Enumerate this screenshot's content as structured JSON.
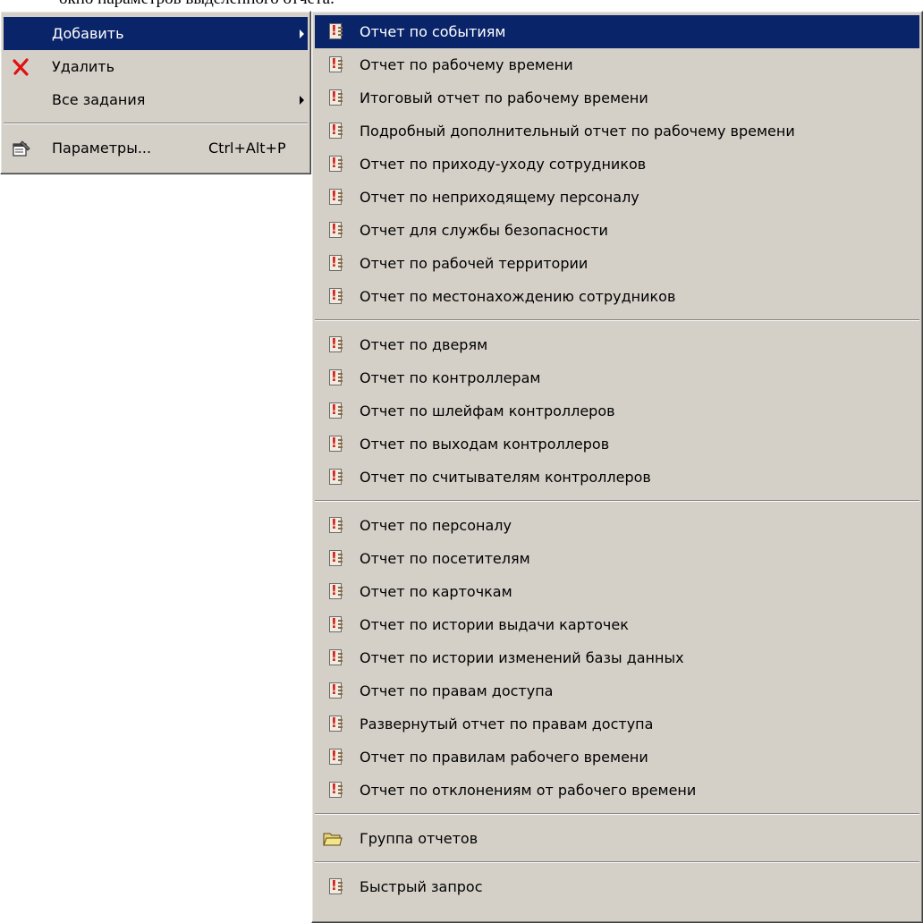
{
  "doc_fragment": "окно параметров выделенного отчета.",
  "context_menu": {
    "items": [
      {
        "label": "Добавить",
        "icon": "none",
        "has_submenu": true,
        "highlighted": true
      },
      {
        "label": "Удалить",
        "icon": "delete-x-icon",
        "has_submenu": false
      },
      {
        "label": "Все задания",
        "icon": "none",
        "has_submenu": true
      },
      {
        "label": "Параметры...",
        "icon": "properties-icon",
        "shortcut": "Ctrl+Alt+P"
      }
    ]
  },
  "submenu": {
    "group1": [
      "Отчет по событиям",
      "Отчет по рабочему времени",
      "Итоговый отчет по рабочему времени",
      "Подробный дополнительный отчет по рабочему времени",
      "Отчет по приходу-уходу сотрудников",
      "Отчет по неприходящему персоналу",
      "Отчет для службы безопасности",
      "Отчет по рабочей территории",
      "Отчет по местонахождению сотрудников"
    ],
    "group2": [
      "Отчет по дверям",
      "Отчет по контроллерам",
      "Отчет по шлейфам контроллеров",
      "Отчет по выходам контроллеров",
      "Отчет по считывателям контроллеров"
    ],
    "group3": [
      "Отчет по персоналу",
      "Отчет по посетителям",
      "Отчет по карточкам",
      "Отчет по истории выдачи карточек",
      "Отчет по истории изменений базы данных",
      "Отчет по правам доступа",
      "Развернутый отчет по правам доступа",
      "Отчет по правилам рабочего времени",
      "Отчет по отклонениям от рабочего времени"
    ],
    "group4": [
      "Группа отчетов"
    ],
    "group5": [
      "Быстрый запрос"
    ],
    "highlighted_item": "Отчет по событиям"
  },
  "colors": {
    "menu_bg": "#d4d0c8",
    "highlight_bg": "#0a246a",
    "highlight_text": "#ffffff",
    "delete_icon": "#e01010"
  },
  "icons": {
    "report": "report-icon",
    "folder": "folder-icon"
  }
}
